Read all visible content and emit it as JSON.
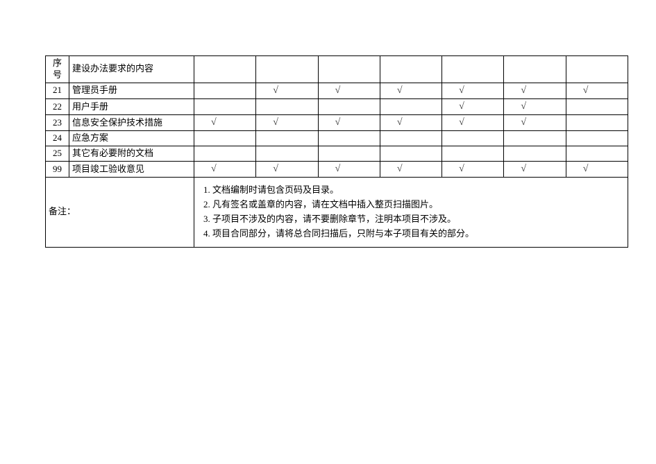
{
  "table": {
    "header": {
      "num_label": "序号",
      "content_label": "建设办法要求的内容"
    },
    "rows": [
      {
        "num": "21",
        "label": "管理员手册",
        "checks": [
          "",
          "√",
          "√",
          "√",
          "√",
          "√",
          "√"
        ]
      },
      {
        "num": "22",
        "label": "用户手册",
        "checks": [
          "",
          "",
          "",
          "",
          "√",
          "√",
          ""
        ]
      },
      {
        "num": "23",
        "label": "信息安全保护技术措施",
        "checks": [
          "√",
          "√",
          "√",
          "√",
          "√",
          "√",
          ""
        ]
      },
      {
        "num": "24",
        "label": "应急方案",
        "checks": [
          "",
          "",
          "",
          "",
          "",
          "",
          ""
        ]
      },
      {
        "num": "25",
        "label": "其它有必要附的文档",
        "checks": [
          "",
          "",
          "",
          "",
          "",
          "",
          ""
        ]
      },
      {
        "num": "99",
        "label": "项目竣工验收意见",
        "checks": [
          "√",
          "√",
          "√",
          "√",
          "√",
          "√",
          "√"
        ]
      }
    ],
    "remark": {
      "label": "备注：",
      "items": [
        "文档编制时请包含页码及目录。",
        "凡有签名或盖章的内容，请在文档中插入整页扫描图片。",
        "子项目不涉及的内容，请不要删除章节，注明本项目不涉及。",
        "项目合同部分，请将总合同扫描后，只附与本子项目有关的部分。"
      ]
    }
  }
}
